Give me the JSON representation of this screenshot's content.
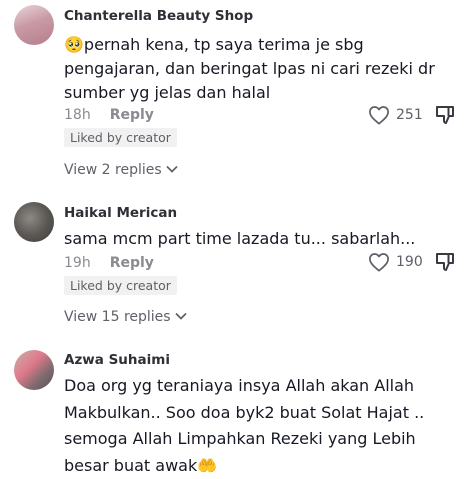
{
  "comments": [
    {
      "author": "Chanterella Beauty Shop",
      "text_line1": "🥺pernah kena, tp saya terima je sbg",
      "text_line2": "pengajaran, dan beringat lpas ni cari rezeki dr",
      "text_line3": "sumber yg jelas dan halal",
      "time": "18h",
      "reply_label": "Reply",
      "likes": "251",
      "liked_by_creator": "Liked by creator",
      "view_replies": "View 2 replies"
    },
    {
      "author": "Haikal Merican",
      "text_line1": "sama mcm part time lazada tu... sabarlah...",
      "time": "19h",
      "reply_label": "Reply",
      "likes": "190",
      "liked_by_creator": "Liked by creator",
      "view_replies": "View 15 replies"
    },
    {
      "author": "Azwa Suhaimi",
      "text_line1": "Doa org yg teraniaya insya Allah akan Allah",
      "text_line2": "Makbulkan.. Soo doa byk2 buat Solat Hajat ..",
      "text_line3": "semoga Allah Limpahkan Rezeki yang Lebih",
      "text_line4": "besar buat awak🤲"
    }
  ]
}
